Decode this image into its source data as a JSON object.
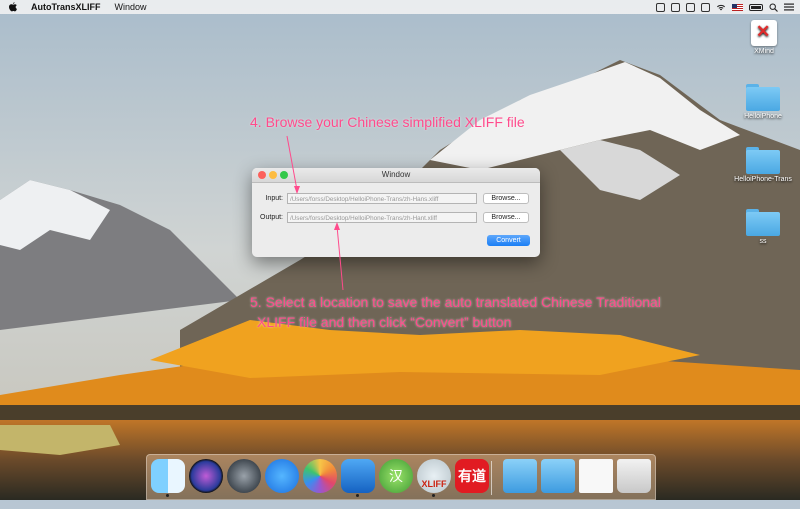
{
  "menubar": {
    "app_name": "AutoTransXLIFF",
    "menu_window": "Window"
  },
  "desktop_icons": [
    {
      "label": "XMind"
    },
    {
      "label": "HelloiPhone"
    },
    {
      "label": "HelloiPhone-Trans"
    },
    {
      "label": "ss"
    }
  ],
  "window": {
    "title": "Window",
    "input_label": "Input:",
    "input_value": "/Users/forss/Desktop/HelloiPhone-Trans/zh-Hans.xliff",
    "output_label": "Output:",
    "output_value": "/Users/forss/Desktop/HelloiPhone-Trans/zh-Hant.xliff",
    "browse_label": "Browse...",
    "convert_label": "Convert"
  },
  "annotations": {
    "step4": "4. Browse your Chinese simplified XLIFF file",
    "step5_line1": "5. Select a location to save the auto translated Chinese Traditional",
    "step5_line2": "XLIFF file and then click “Convert” button"
  },
  "dock": {
    "items": [
      "finder-icon",
      "siri-icon",
      "launchpad-icon",
      "app-store-icon",
      "photos-icon",
      "xcode-icon",
      "hanzi-icon",
      "autotransxliff-icon",
      "youdao-icon",
      "applications-folder-icon",
      "downloads-folder-icon",
      "document-stack-icon",
      "trash-icon"
    ],
    "hanzi_label": "汉",
    "youdao_label": "有道",
    "xliff_label": "XLIFF"
  },
  "colors": {
    "annotation": "#ff4b8c",
    "convert_button": "#1a7ef5"
  }
}
